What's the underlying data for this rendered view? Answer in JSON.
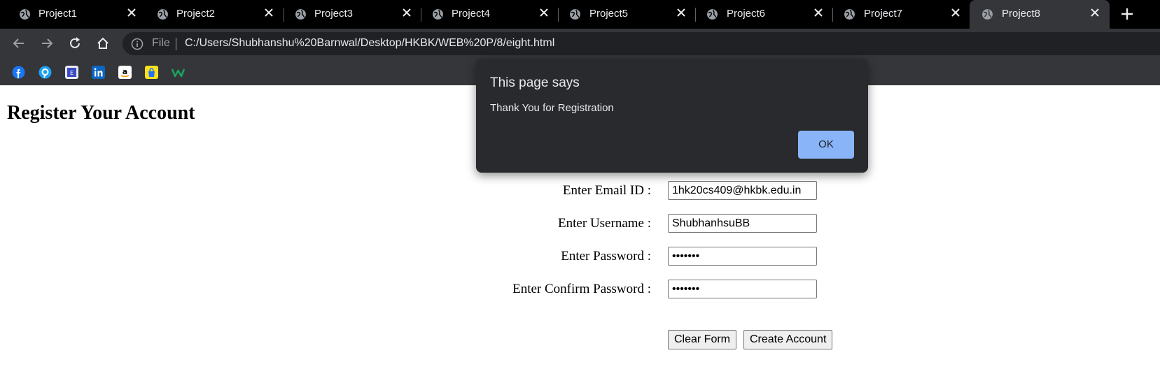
{
  "browser": {
    "tabs": [
      {
        "title": "Project1"
      },
      {
        "title": "Project2"
      },
      {
        "title": "Project3"
      },
      {
        "title": "Project4"
      },
      {
        "title": "Project5"
      },
      {
        "title": "Project6"
      },
      {
        "title": "Project7"
      },
      {
        "title": "Project8",
        "active": true
      }
    ],
    "omnibox": {
      "scheme_label": "File",
      "url": "C:/Users/Shubhanshu%20Barnwal/Desktop/HKBK/WEB%20P/8/eight.html"
    },
    "bookmarks": [
      {
        "icon": "facebook-icon",
        "color": "#1877f2"
      },
      {
        "icon": "jiosaavn-icon",
        "color": "#1da1f2"
      },
      {
        "icon": "college-logo-icon",
        "color": "#3b4cc0"
      },
      {
        "icon": "linkedin-icon",
        "color": "#0a66c2"
      },
      {
        "icon": "amazon-icon",
        "color": "#ffffff"
      },
      {
        "icon": "flipkart-icon",
        "color": "#ffe11b"
      },
      {
        "icon": "w-logo-icon",
        "color": "#1aa260"
      }
    ]
  },
  "page": {
    "heading": "Register Your Account",
    "fields": {
      "email_label": "Enter Email ID :",
      "email_value": "1hk20cs409@hkbk.edu.in",
      "username_label": "Enter Username :",
      "username_value": "ShubhanhsuBB",
      "password_label": "Enter Password :",
      "password_value": "•••••••",
      "confirm_label": "Enter Confirm Password :",
      "confirm_value": "•••••••"
    },
    "buttons": {
      "clear": "Clear Form",
      "create": "Create Account"
    }
  },
  "dialog": {
    "title": "This page says",
    "message": "Thank You for Registration",
    "ok_label": "OK"
  },
  "colors": {
    "tabstrip_bg": "#000000",
    "toolbar_bg": "#35363a",
    "dialog_bg": "#292a2d",
    "ok_button": "#8ab4f8"
  }
}
